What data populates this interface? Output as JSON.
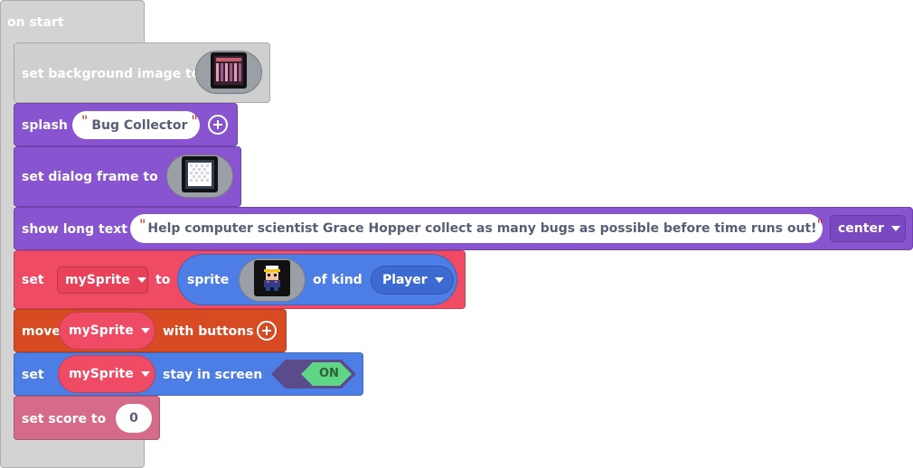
{
  "colors": {
    "event": "#d3d3d3",
    "scene": "#cfcfcf",
    "game": "#8854d0",
    "sprites": "#ef4b64",
    "controller": "#d84a22",
    "sprite_props": "#4c7ee6",
    "info": "#d56b88",
    "toggle_on": "#5fd685",
    "toggle_frame": "#5b4a8c"
  },
  "event_block": {
    "label": "on start"
  },
  "blocks": {
    "set_background": {
      "label": "set background image to",
      "image_icon": "background-image-icon"
    },
    "splash": {
      "label": "splash",
      "text": "Bug Collector",
      "add_icon": "plus-circle-icon"
    },
    "set_dialog_frame": {
      "label": "set dialog frame to",
      "image_icon": "dialog-frame-icon"
    },
    "show_long_text": {
      "label": "show long text",
      "text": "Help computer scientist Grace Hopper collect as many bugs as possible before time runs out!",
      "position": "center"
    },
    "set_sprite": {
      "set_label": "set",
      "variable": "mySprite",
      "to_label": "to",
      "sprite_label": "sprite",
      "image_icon": "grace-hopper-sprite-icon",
      "kind_label": "of kind",
      "kind": "Player"
    },
    "move_sprite": {
      "label": "move",
      "variable": "mySprite",
      "suffix": "with buttons",
      "add_icon": "plus-circle-icon"
    },
    "stay_in_screen": {
      "set_label": "set",
      "variable": "mySprite",
      "suffix": "stay in screen",
      "toggle": "ON"
    },
    "set_score": {
      "label": "set score to",
      "value": "0"
    }
  }
}
